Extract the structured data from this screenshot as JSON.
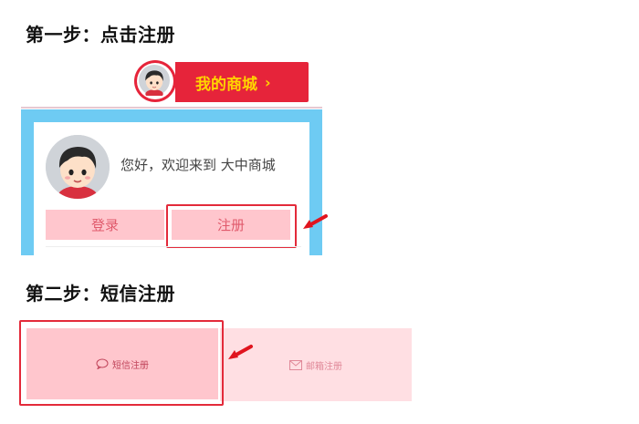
{
  "step1": {
    "title": "第一步：点击注册"
  },
  "mall_bar": {
    "label": "我的商城",
    "chevron": "›"
  },
  "welcome": {
    "text": "您好，欢迎来到 大中商城"
  },
  "buttons": {
    "login": "登录",
    "register": "注册"
  },
  "step2": {
    "title": "第二步：短信注册"
  },
  "tabs": {
    "sms": "短信注册",
    "email": "邮箱注册"
  },
  "icons": {
    "avatar": "avatar-cartoon",
    "sms": "chat-bubble-icon",
    "email": "envelope-icon",
    "arrow": "red-arrow-icon"
  },
  "colors": {
    "mall_bar": "#e6243a",
    "mall_text": "#ffd400",
    "panel_border": "#6ecbf3",
    "button_bg": "#ffc6cd",
    "button_text": "#e05a6c",
    "highlight": "#e32a3a"
  }
}
